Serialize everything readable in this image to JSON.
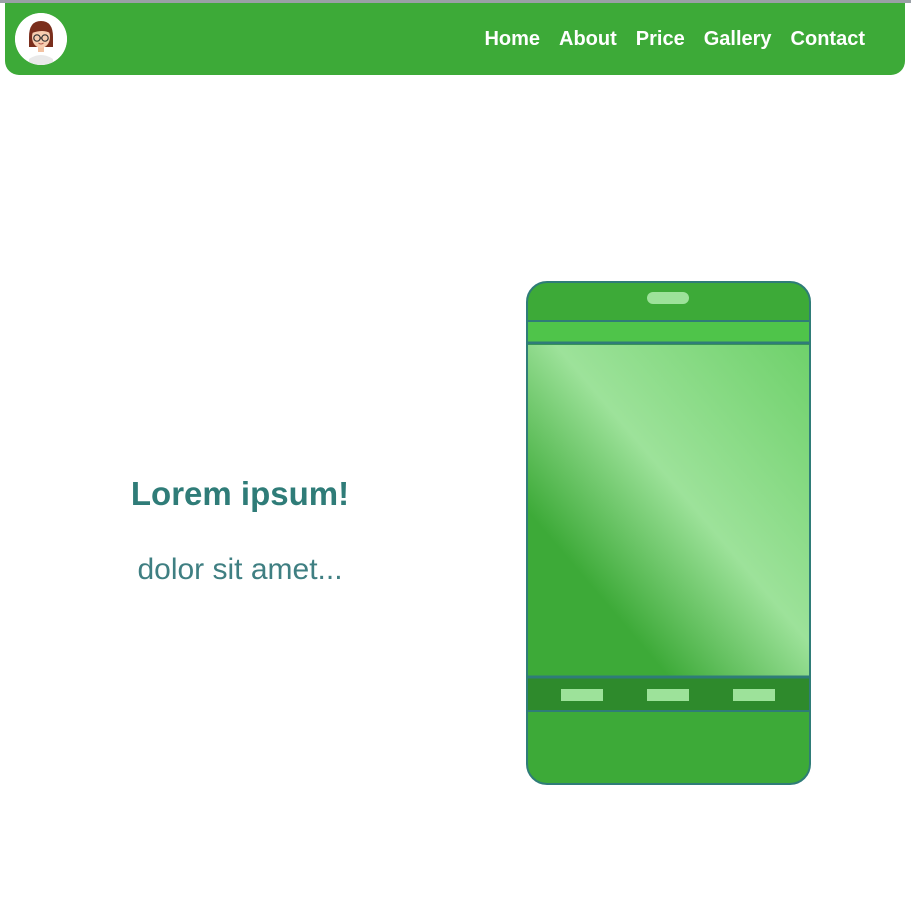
{
  "navbar": {
    "links": [
      "Home",
      "About",
      "Price",
      "Gallery",
      "Contact"
    ]
  },
  "hero": {
    "title": "Lorem ipsum!",
    "subtitle": "dolor sit amet..."
  },
  "colors": {
    "primary_green": "#3daa38",
    "accent_teal": "#2f7c78",
    "phone_dark": "#2e8a2c",
    "phone_light": "#9de29a"
  },
  "icons": {
    "avatar": "woman-avatar",
    "phone": "smartphone-illustration"
  }
}
